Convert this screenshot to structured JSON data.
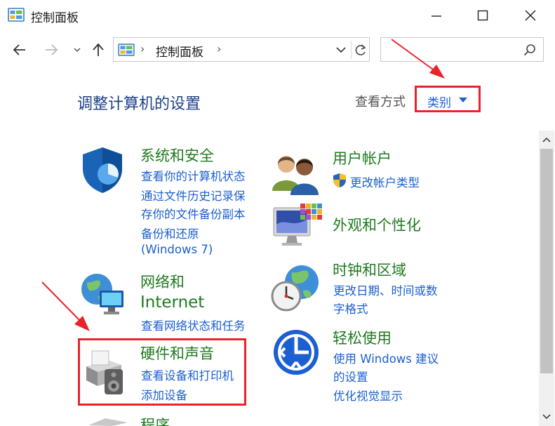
{
  "window": {
    "title": "控制面板"
  },
  "address": {
    "crumb": "控制面板",
    "separator": "›",
    "search_placeholder": ""
  },
  "header": {
    "title": "调整计算机的设置",
    "view_label": "查看方式",
    "view_value": "类别"
  },
  "categories": [
    {
      "title": "系统和安全",
      "icon": "shield-icon",
      "links": [
        "查看你的计算机状态",
        "通过文件历史记录保",
        "存你的文件备份副本",
        "备份和还原",
        "(Windows 7)"
      ]
    },
    {
      "title_line1": "网络和",
      "title_line2": "Internet",
      "icon": "network-globe-icon",
      "links": [
        "查看网络状态和任务"
      ]
    },
    {
      "title": "硬件和声音",
      "icon": "printer-speaker-icon",
      "links": [
        "查看设备和打印机",
        "添加设备"
      ]
    },
    {
      "title": "程序",
      "icon": "programs-icon",
      "links": []
    },
    {
      "title": "用户帐户",
      "icon": "users-icon",
      "links": [
        "更改帐户类型"
      ]
    },
    {
      "title": "外观和个性化",
      "icon": "monitor-personalize-icon",
      "links": []
    },
    {
      "title": "时钟和区域",
      "icon": "clock-globe-icon",
      "links": [
        "更改日期、时间或数",
        "字格式"
      ]
    },
    {
      "title": "轻松使用",
      "icon": "ease-of-access-icon",
      "links": [
        "使用 Windows 建议",
        "的设置",
        "优化视觉显示"
      ]
    }
  ],
  "colors": {
    "accent_link": "#1b5fd0",
    "category_title": "#1f7a1f",
    "page_title": "#1e3f8a",
    "annotation_red": "#e8242b"
  }
}
